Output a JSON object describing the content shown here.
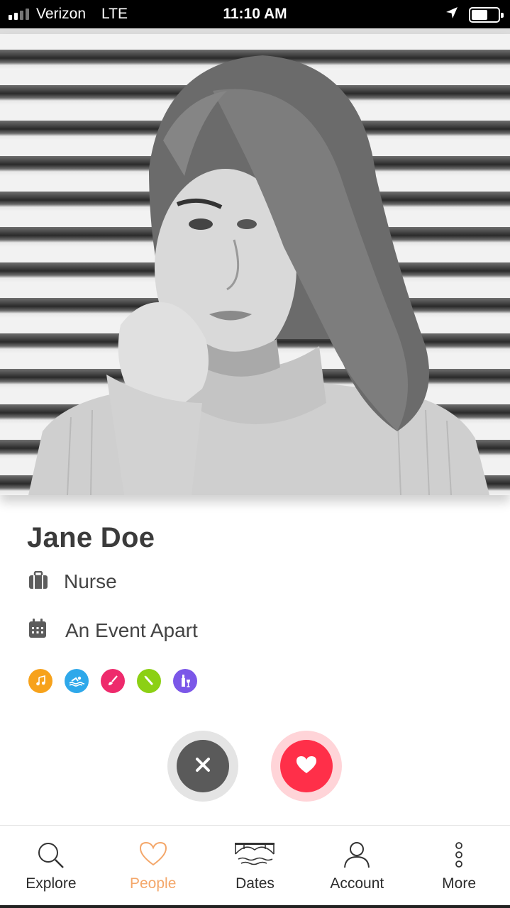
{
  "status_bar": {
    "carrier": "Verizon",
    "network": "LTE",
    "time": "11:10 AM",
    "icons": [
      "signal-icon",
      "location-arrow-icon",
      "battery-icon"
    ]
  },
  "profile": {
    "photo_description_icon": "profile-photo",
    "name": "Jane Doe",
    "job": "Nurse",
    "job_icon": "briefcase-icon",
    "event": "An Event Apart",
    "event_icon": "calendar-icon",
    "interests": [
      {
        "icon": "music-icon",
        "color": "#f7a21b"
      },
      {
        "icon": "swimming-icon",
        "color": "#2ea8ea"
      },
      {
        "icon": "paintbrush-icon",
        "color": "#ee2a6c"
      },
      {
        "icon": "baseball-bat-icon",
        "color": "#8cd014"
      },
      {
        "icon": "wine-icon",
        "color": "#7b57e8"
      }
    ]
  },
  "actions": {
    "pass_icon": "close-icon",
    "like_icon": "heart-icon",
    "pass_color": "#5a5a5a",
    "like_color": "#ff2f49"
  },
  "tab_bar": {
    "active_color": "#f4a76a",
    "tabs": [
      {
        "label": "Explore",
        "icon": "search-icon"
      },
      {
        "label": "People",
        "icon": "heart-outline-icon",
        "active": true
      },
      {
        "label": "Dates",
        "icon": "bridge-icon"
      },
      {
        "label": "Account",
        "icon": "person-icon"
      },
      {
        "label": "More",
        "icon": "more-vertical-icon"
      }
    ]
  }
}
